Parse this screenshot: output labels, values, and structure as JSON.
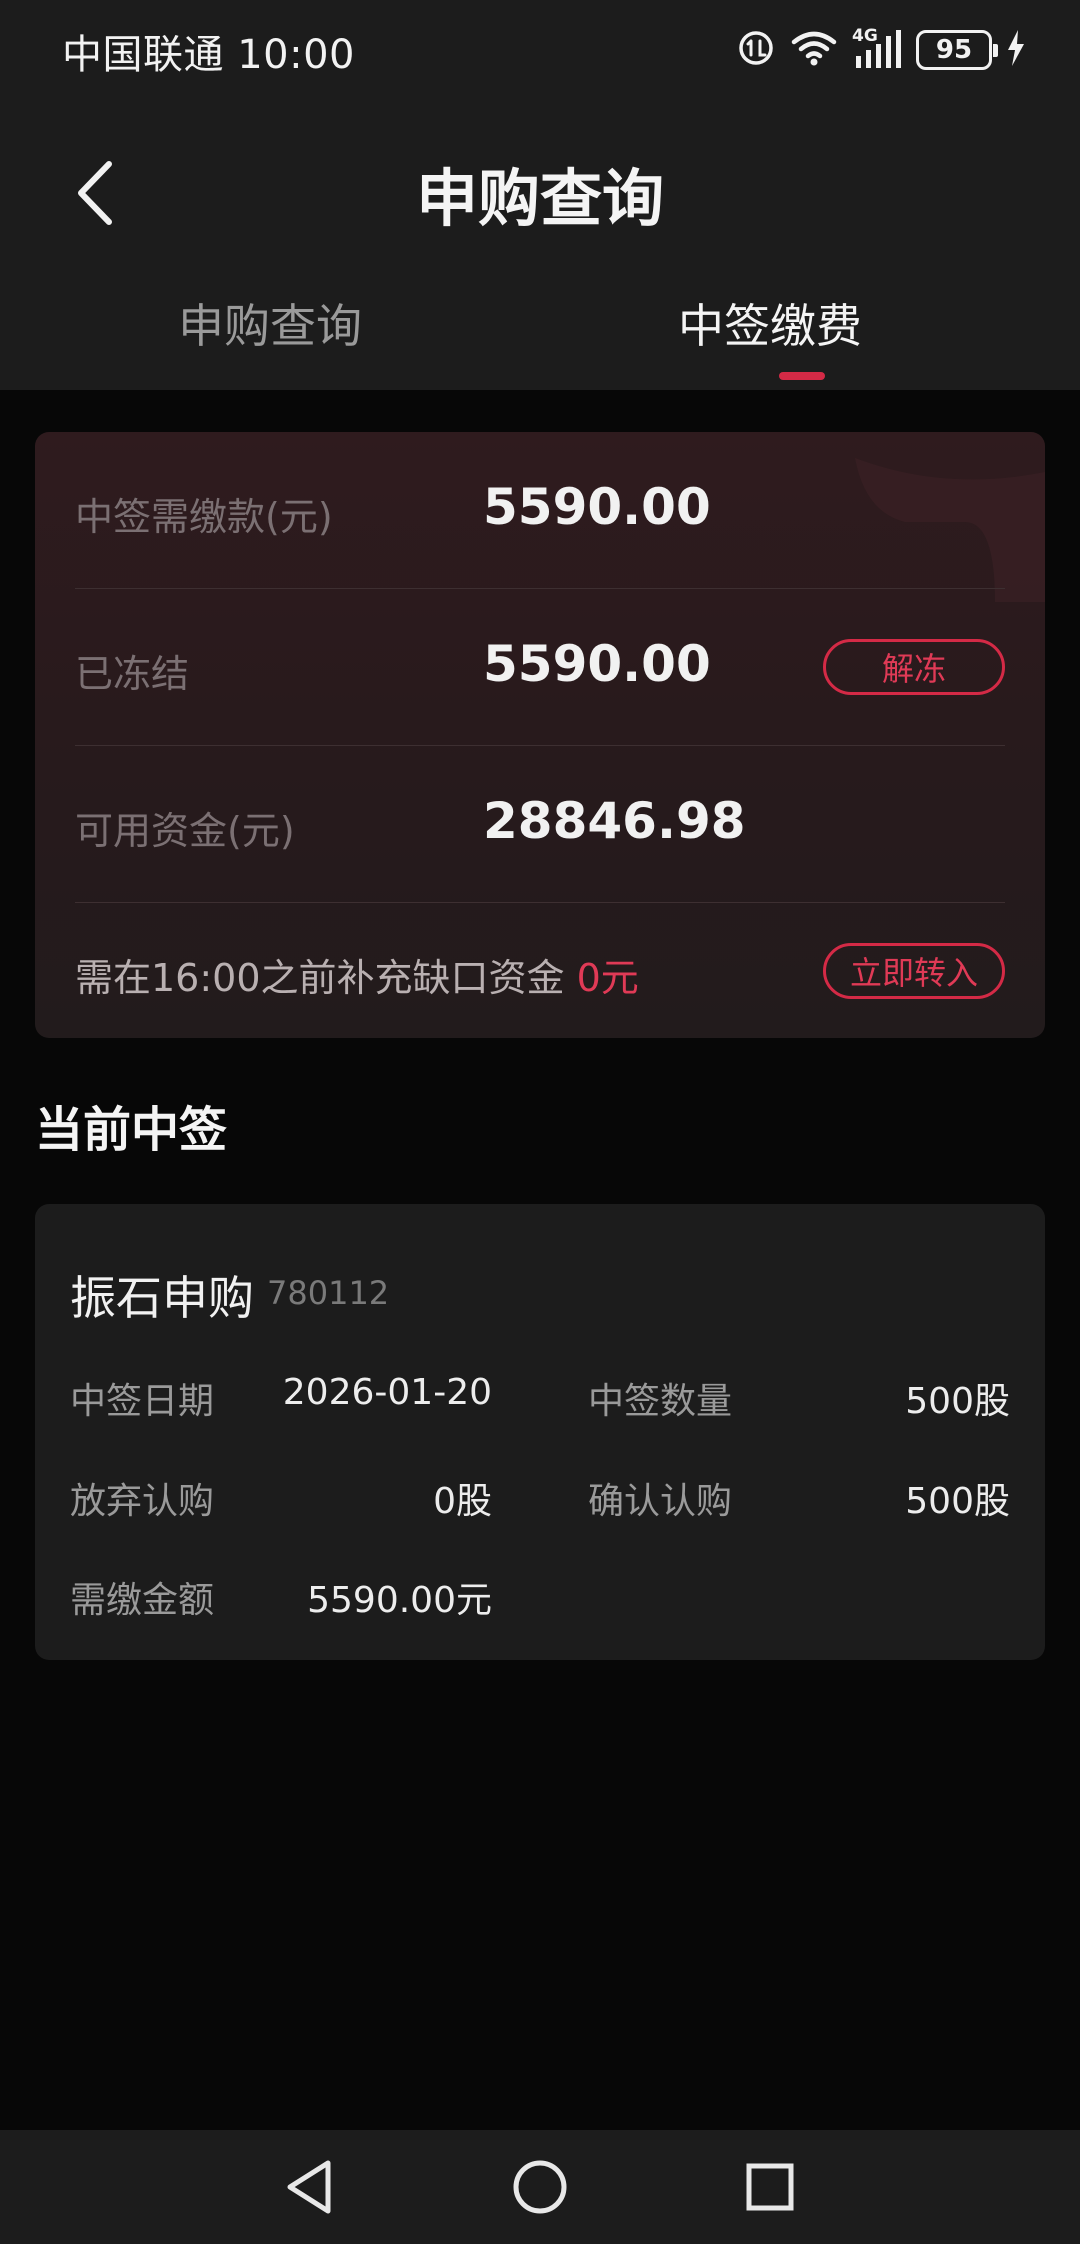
{
  "status_bar": {
    "carrier_time": "中国联通 10:00",
    "network": "4G",
    "battery": "95"
  },
  "header": {
    "title": "申购查询",
    "tabs": [
      {
        "label": "申购查询",
        "active": false
      },
      {
        "label": "中签缴费",
        "active": true
      }
    ]
  },
  "summary": {
    "rows": [
      {
        "label": "中签需缴款(元)",
        "value": "5590.00"
      },
      {
        "label": "已冻结",
        "value": "5590.00",
        "button": "解冻"
      },
      {
        "label": "可用资金(元)",
        "value": "28846.98"
      }
    ],
    "notice_text": "需在16:00之前补充缺口资金 ",
    "notice_amount": "0元",
    "transfer_button": "立即转入"
  },
  "current_section": {
    "title": "当前中签"
  },
  "allotment": {
    "name": "振石申购",
    "code": "780112",
    "fields": {
      "win_date_label": "中签日期",
      "win_date": "2026-01-20",
      "win_qty_label": "中签数量",
      "win_qty": "500股",
      "abandon_label": "放弃认购",
      "abandon": "0股",
      "confirm_label": "确认认购",
      "confirm": "500股",
      "amount_label": "需缴金额",
      "amount": "5590.00元"
    }
  },
  "colors": {
    "accent": "#d42a46",
    "background": "#070707",
    "surface": "#1c1c1c"
  },
  "icons": {
    "back": "chevron-left-icon",
    "nav_back": "triangle-back-icon",
    "nav_home": "circle-home-icon",
    "nav_recent": "square-recent-icon"
  }
}
